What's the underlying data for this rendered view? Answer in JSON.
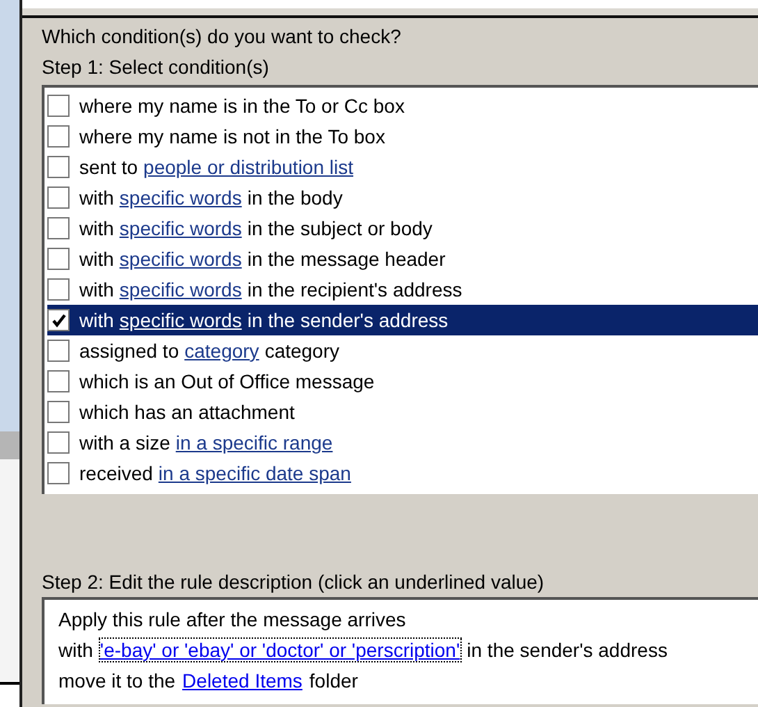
{
  "dialog": {
    "question": "Which condition(s) do you want to check?",
    "step1_label": "Step 1: Select condition(s)",
    "conditions": [
      {
        "checked": false,
        "selected": false,
        "parts": [
          {
            "kind": "text",
            "text": "where my name is in the To or Cc box"
          }
        ]
      },
      {
        "checked": false,
        "selected": false,
        "parts": [
          {
            "kind": "text",
            "text": "where my name is not in the To box"
          }
        ]
      },
      {
        "checked": false,
        "selected": false,
        "parts": [
          {
            "kind": "text",
            "text": "sent to"
          },
          {
            "kind": "link",
            "text": "people or distribution list"
          }
        ]
      },
      {
        "checked": false,
        "selected": false,
        "parts": [
          {
            "kind": "text",
            "text": "with"
          },
          {
            "kind": "link",
            "text": "specific words"
          },
          {
            "kind": "text",
            "text": "in the body"
          }
        ]
      },
      {
        "checked": false,
        "selected": false,
        "parts": [
          {
            "kind": "text",
            "text": "with"
          },
          {
            "kind": "link",
            "text": "specific words"
          },
          {
            "kind": "text",
            "text": "in the subject or body"
          }
        ]
      },
      {
        "checked": false,
        "selected": false,
        "parts": [
          {
            "kind": "text",
            "text": "with"
          },
          {
            "kind": "link",
            "text": "specific words"
          },
          {
            "kind": "text",
            "text": "in the message header"
          }
        ]
      },
      {
        "checked": false,
        "selected": false,
        "parts": [
          {
            "kind": "text",
            "text": "with"
          },
          {
            "kind": "link",
            "text": "specific words"
          },
          {
            "kind": "text",
            "text": "in the recipient's address"
          }
        ]
      },
      {
        "checked": true,
        "selected": true,
        "parts": [
          {
            "kind": "text",
            "text": "with"
          },
          {
            "kind": "link",
            "text": "specific words"
          },
          {
            "kind": "text",
            "text": "in the sender's address"
          }
        ]
      },
      {
        "checked": false,
        "selected": false,
        "parts": [
          {
            "kind": "text",
            "text": "assigned to"
          },
          {
            "kind": "link",
            "text": "category"
          },
          {
            "kind": "text",
            "text": "category"
          }
        ]
      },
      {
        "checked": false,
        "selected": false,
        "parts": [
          {
            "kind": "text",
            "text": "which is an Out of Office message"
          }
        ]
      },
      {
        "checked": false,
        "selected": false,
        "parts": [
          {
            "kind": "text",
            "text": "which has an attachment"
          }
        ]
      },
      {
        "checked": false,
        "selected": false,
        "parts": [
          {
            "kind": "text",
            "text": "with a size"
          },
          {
            "kind": "link",
            "text": "in a specific range"
          }
        ]
      },
      {
        "checked": false,
        "selected": false,
        "parts": [
          {
            "kind": "text",
            "text": "received"
          },
          {
            "kind": "link",
            "text": "in a specific date span"
          }
        ]
      }
    ],
    "step2_label": "Step 2: Edit the rule description (click an underlined value)",
    "description": [
      [
        {
          "kind": "text",
          "text": "Apply this rule after the message arrives"
        }
      ],
      [
        {
          "kind": "text",
          "text": "with"
        },
        {
          "kind": "link",
          "focused": true,
          "text": "'e-bay' or 'ebay' or 'doctor' or 'perscription'"
        },
        {
          "kind": "text",
          "text": "in the sender's address"
        }
      ],
      [
        {
          "kind": "text",
          "text": "move it to the"
        },
        {
          "kind": "link",
          "focused": false,
          "text": "Deleted Items"
        },
        {
          "kind": "text",
          "text": "folder"
        }
      ]
    ]
  }
}
